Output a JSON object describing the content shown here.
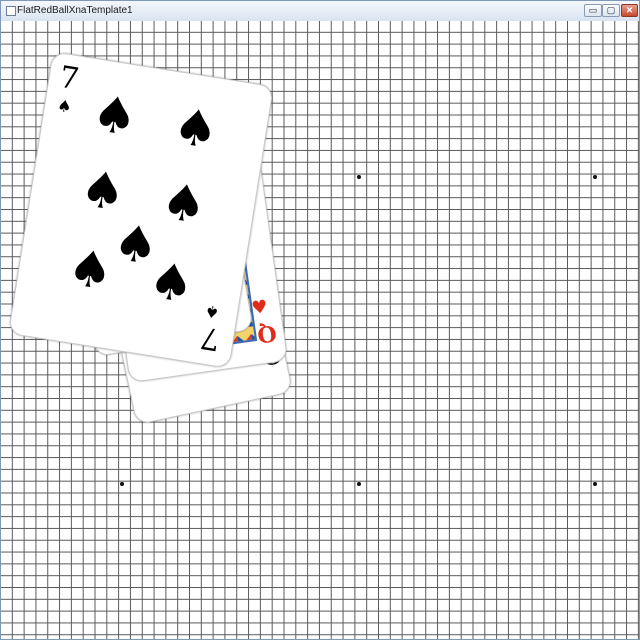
{
  "window": {
    "title": "FlatRedBallXnaTemplate1",
    "buttons": {
      "minimize": "▭",
      "maximize": "▢",
      "close": "✕"
    }
  },
  "cards": [
    {
      "rank": "Q",
      "suit": "spades",
      "suit_symbol": "♠",
      "color": "#111111"
    },
    {
      "rank": "Q",
      "suit": "hearts",
      "suit_symbol": "♥",
      "color": "#e02d1b"
    },
    {
      "rank": "Q",
      "suit": "spades",
      "suit_symbol": "♠",
      "color": "#111111"
    },
    {
      "rank": "7",
      "suit": "spades",
      "suit_symbol": "♠",
      "color": "#000000"
    }
  ],
  "colors": {
    "grid_line": "#595959",
    "title_bar": "#d9e4f1",
    "close_button": "#c34a2e"
  }
}
